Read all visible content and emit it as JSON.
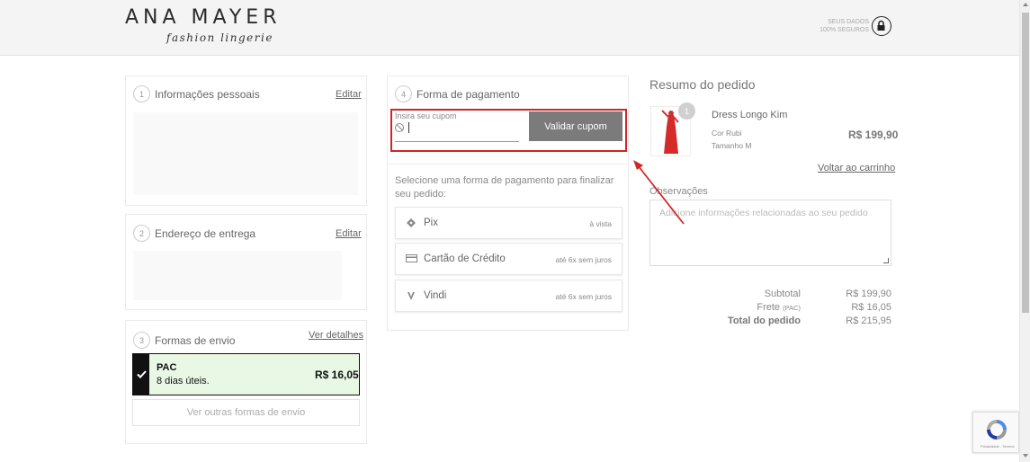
{
  "header": {
    "logo_main": "ANA MAYER",
    "logo_sub": "fashion lingerie",
    "secure_line1": "SEUS DADOS",
    "secure_line2": "100% SEGUROS"
  },
  "personal": {
    "step": "1",
    "title": "Informações pessoais",
    "edit": "Editar"
  },
  "delivery": {
    "step": "2",
    "title": "Endereço de entrega",
    "edit": "Editar"
  },
  "shipping": {
    "step": "3",
    "title": "Formas de envio",
    "details": "Ver detalhes",
    "selected_name": "PAC",
    "selected_days": "8 dias úteis.",
    "selected_price": "R$ 16,05",
    "other_options": "Ver outras formas de envio"
  },
  "payment": {
    "step": "4",
    "title": "Forma de pagamento",
    "coupon_label": "Insira seu cupom",
    "coupon_value": "",
    "coupon_button": "Validar cupom",
    "instruction": "Selecione uma forma de pagamento para finalizar seu pedido:",
    "options": [
      {
        "name": "Pix",
        "terms": "à vista",
        "icon": "pix-icon"
      },
      {
        "name": "Cartão de Crédito",
        "terms": "até 6x sem juros",
        "icon": "credit-card-icon"
      },
      {
        "name": "Vindi",
        "terms": "até 6x sem juros",
        "icon": "vindi-icon"
      }
    ]
  },
  "summary": {
    "title": "Resumo do pedido",
    "product": {
      "name": "Dress Longo Kim",
      "color": "Cor Rubi",
      "size": "Tamanho M",
      "price": "R$ 199,90",
      "quantity": "1"
    },
    "back_to_cart": "Voltar ao carrinho",
    "notes_label": "Observações",
    "notes_placeholder": "Adicione informações relacionadas ao seu pedido",
    "subtotal_label": "Subtotal",
    "subtotal_value": "R$ 199,90",
    "shipping_label": "Frete",
    "shipping_method": "(PAC)",
    "shipping_value": "R$ 16,05",
    "total_label": "Total do pedido",
    "total_value": "R$ 215,95"
  },
  "colors": {
    "highlight": "#d12626",
    "selected_bg": "#e9f7e5",
    "button": "#7b7b7b"
  },
  "recaptcha": {
    "text": "Privacidade - Termos"
  }
}
